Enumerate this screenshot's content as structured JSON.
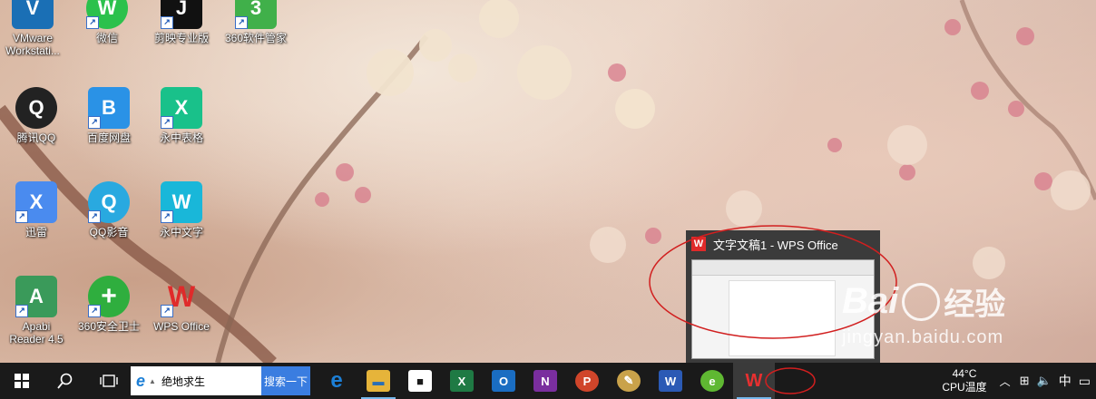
{
  "desktop": {
    "icons": [
      {
        "label": "VMware Workstati...",
        "color": "#1a6fb5",
        "glyph": "V"
      },
      {
        "label": "微信",
        "color": "#2bc14c",
        "glyph": "W"
      },
      {
        "label": "剪映专业版",
        "color": "#111111",
        "glyph": "J"
      },
      {
        "label": "360软件管家",
        "color": "#40b04a",
        "glyph": "3"
      },
      {
        "label": "腾讯QQ",
        "color": "#111111",
        "glyph": "Q"
      },
      {
        "label": "百度网盘",
        "color": "#2a92e6",
        "glyph": "B"
      },
      {
        "label": "永中表格",
        "color": "#19c18a",
        "glyph": "X"
      },
      {
        "label": "迅雷",
        "color": "#4a8bef",
        "glyph": "X"
      },
      {
        "label": "QQ影音",
        "color": "#29a9e0",
        "glyph": "Q"
      },
      {
        "label": "永中文字",
        "color": "#19b7d9",
        "glyph": "W"
      },
      {
        "label": "Apabi Reader 4.5",
        "color": "#3a9a5a",
        "glyph": "A"
      },
      {
        "label": "360安全卫士",
        "color": "#2fae3e",
        "glyph": "+"
      },
      {
        "label": "WPS Office",
        "color": "#e02a2a",
        "glyph": "W"
      }
    ]
  },
  "taskbar": {
    "search_text": "绝地求生",
    "search_button": "搜索一下",
    "apps": [
      {
        "name": "edge",
        "color": "#1c7fd6",
        "glyph": "e"
      },
      {
        "name": "explorer",
        "color": "#e6b43a",
        "glyph": "▬"
      },
      {
        "name": "store",
        "color": "#444444",
        "glyph": "■"
      },
      {
        "name": "excel",
        "color": "#1f7a44",
        "glyph": "X"
      },
      {
        "name": "outlook",
        "color": "#1a6dc2",
        "glyph": "O"
      },
      {
        "name": "onenote",
        "color": "#7a2e9e",
        "glyph": "N"
      },
      {
        "name": "powerpoint",
        "color": "#d0452a",
        "glyph": "P"
      },
      {
        "name": "paint",
        "color": "#c9a24a",
        "glyph": "✎"
      },
      {
        "name": "word",
        "color": "#2b5ab5",
        "glyph": "W"
      },
      {
        "name": "360browser",
        "color": "#5fb832",
        "glyph": "e"
      },
      {
        "name": "wps",
        "color": "#e02a2a",
        "glyph": "W"
      }
    ],
    "temp": "44°C",
    "cpu_label": "CPU温度",
    "ime": "中"
  },
  "preview": {
    "title": "文字文稿1 - WPS Office"
  },
  "watermark": {
    "brand": "Bai",
    "brand2": "经验",
    "url": "jingyan.baidu.com"
  }
}
